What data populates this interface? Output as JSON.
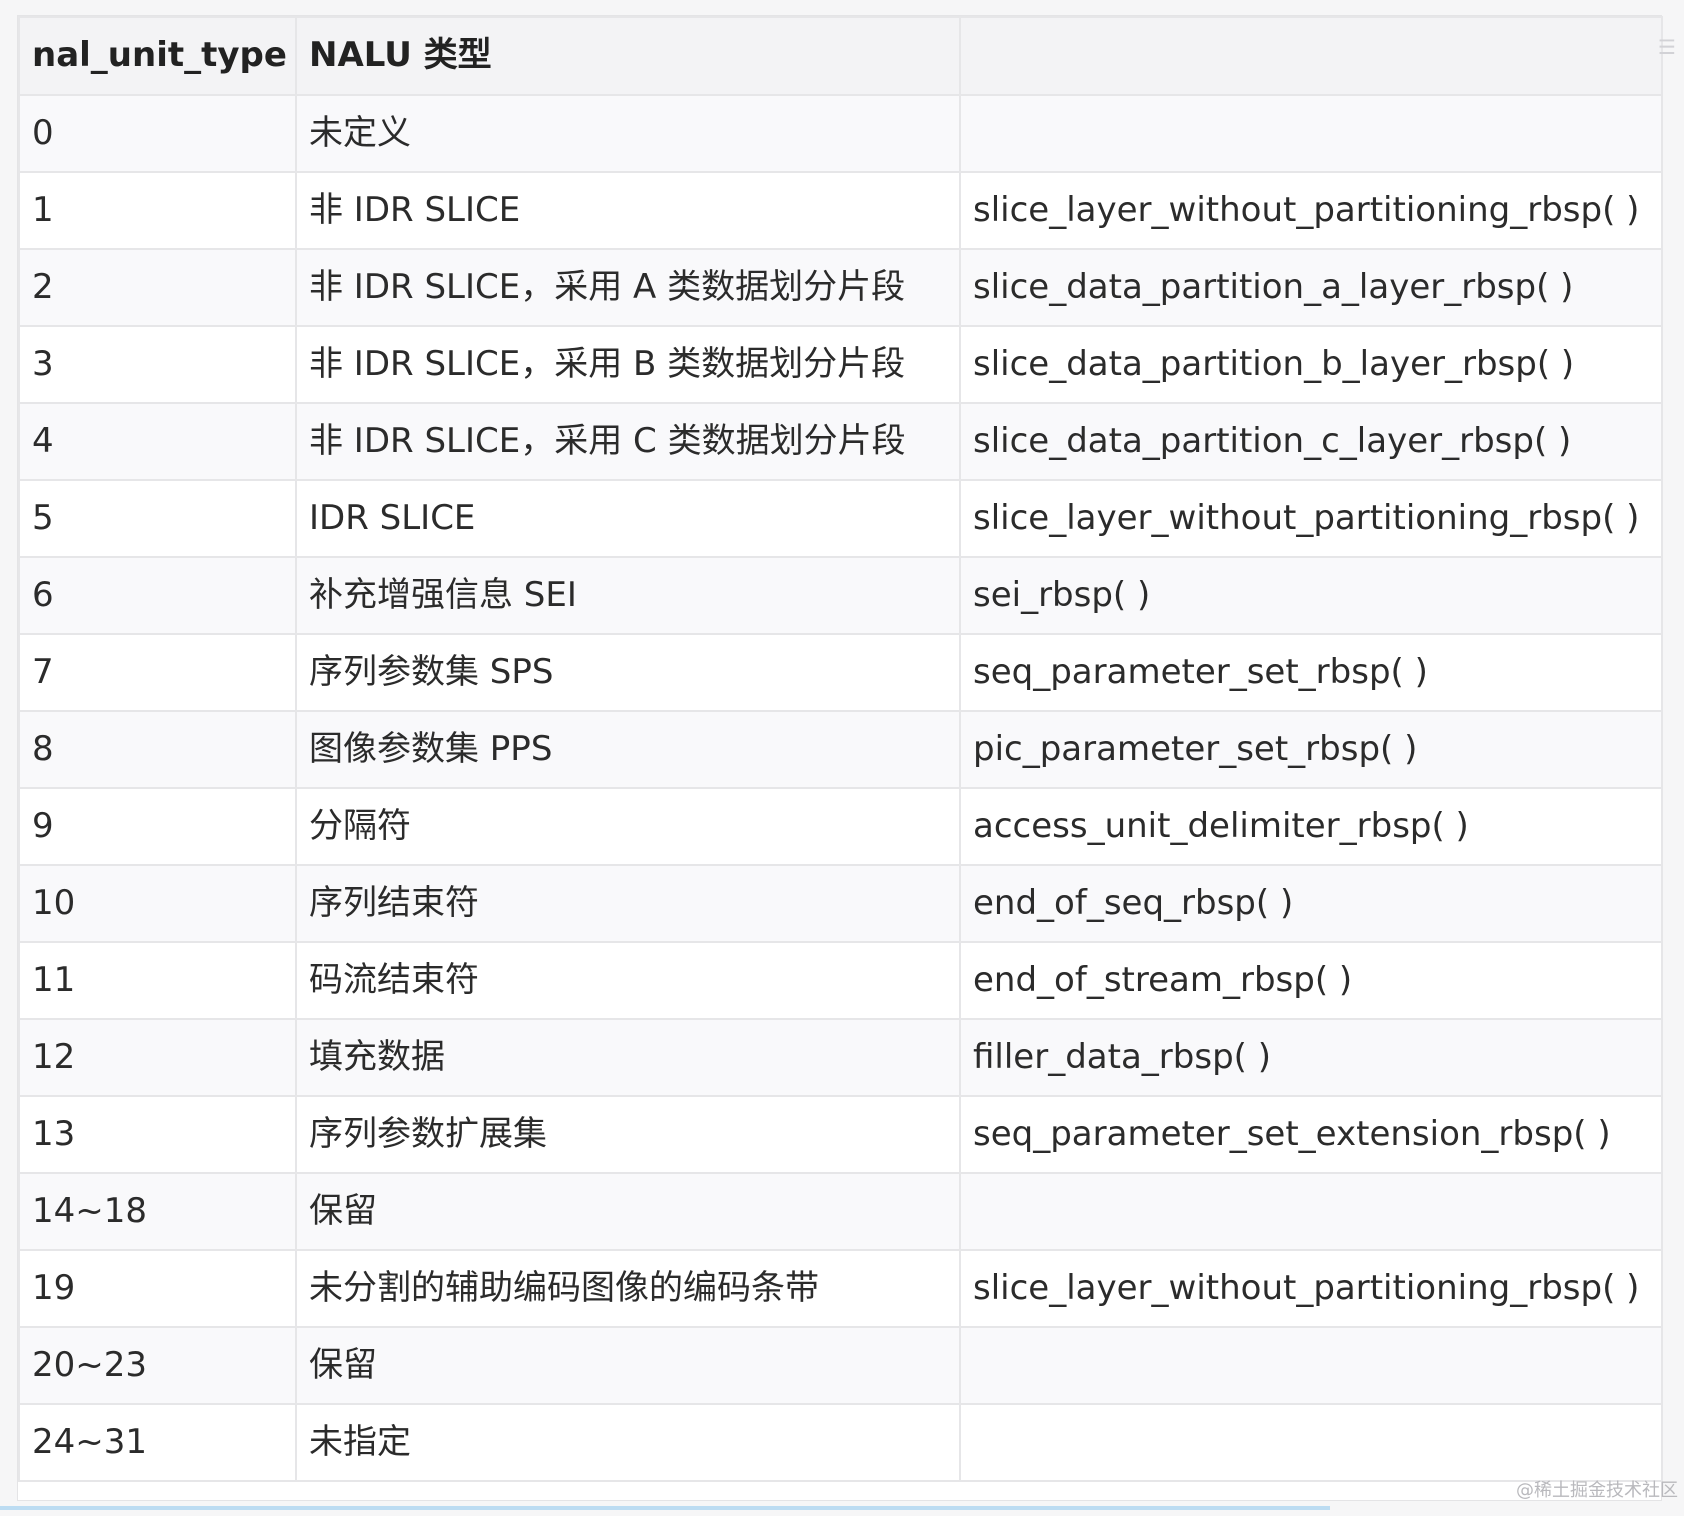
{
  "table": {
    "headers": [
      "nal_unit_type",
      "NALU 类型",
      ""
    ],
    "rows": [
      [
        "0",
        "未定义",
        ""
      ],
      [
        "1",
        "非 IDR SLICE",
        "slice_layer_without_partitioning_rbsp( )"
      ],
      [
        "2",
        "非 IDR SLICE，采用 A 类数据划分片段",
        "slice_data_partition_a_layer_rbsp( )"
      ],
      [
        "3",
        "非 IDR SLICE，采用 B 类数据划分片段",
        "slice_data_partition_b_layer_rbsp( )"
      ],
      [
        "4",
        "非 IDR SLICE，采用 C 类数据划分片段",
        "slice_data_partition_c_layer_rbsp( )"
      ],
      [
        "5",
        "IDR SLICE",
        "slice_layer_without_partitioning_rbsp( )"
      ],
      [
        "6",
        "补充增强信息 SEI",
        "sei_rbsp( )"
      ],
      [
        "7",
        "序列参数集 SPS",
        "seq_parameter_set_rbsp( )"
      ],
      [
        "8",
        "图像参数集 PPS",
        "pic_parameter_set_rbsp( )"
      ],
      [
        "9",
        "分隔符",
        "access_unit_delimiter_rbsp( )"
      ],
      [
        "10",
        "序列结束符",
        "end_of_seq_rbsp( )"
      ],
      [
        "11",
        "码流结束符",
        "end_of_stream_rbsp( )"
      ],
      [
        "12",
        "填充数据",
        "filler_data_rbsp( )"
      ],
      [
        "13",
        "序列参数扩展集",
        "seq_parameter_set_extension_rbsp( )"
      ],
      [
        "14~18",
        "保留",
        ""
      ],
      [
        "19",
        "未分割的辅助编码图像的编码条带",
        "slice_layer_without_partitioning_rbsp( )"
      ],
      [
        "20~23",
        "保留",
        ""
      ],
      [
        "24~31",
        "未指定",
        ""
      ]
    ]
  },
  "watermark": "@稀土掘金技术社区"
}
